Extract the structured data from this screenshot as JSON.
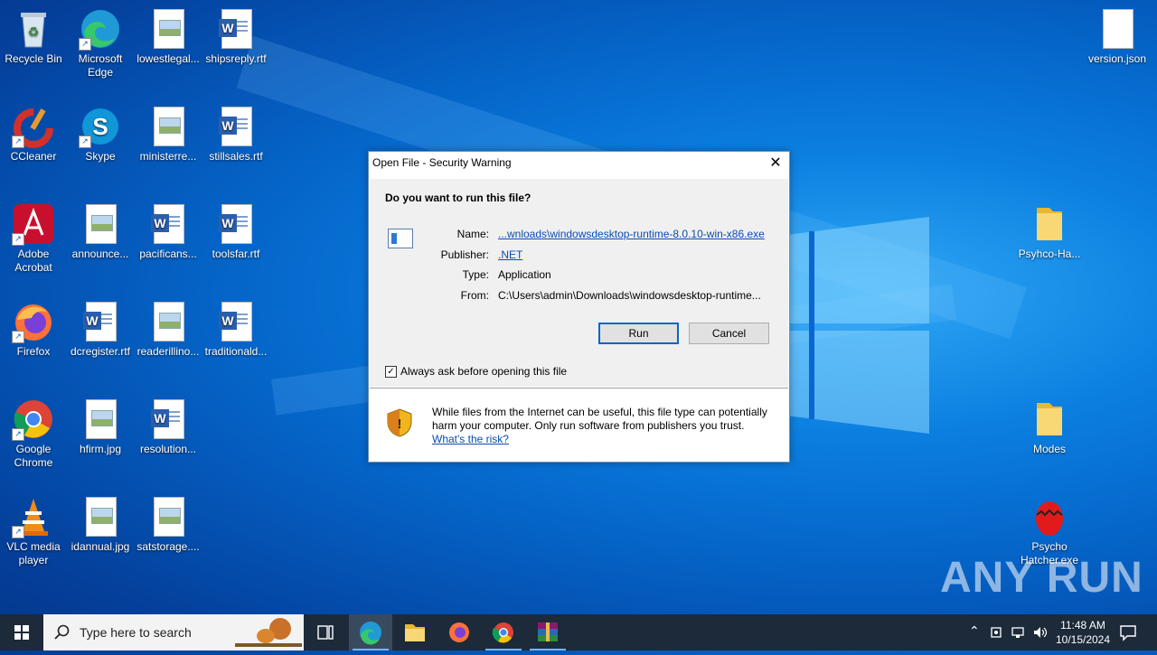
{
  "desktop": {
    "icons": [
      {
        "label": "Recycle Bin"
      },
      {
        "label": "Microsoft Edge"
      },
      {
        "label": "lowestlegal..."
      },
      {
        "label": "shipsreply.rtf"
      },
      {
        "label": "CCleaner"
      },
      {
        "label": "Skype"
      },
      {
        "label": "ministerre..."
      },
      {
        "label": "stillsales.rtf"
      },
      {
        "label": "Adobe Acrobat"
      },
      {
        "label": "announce..."
      },
      {
        "label": "pacificans..."
      },
      {
        "label": "toolsfar.rtf"
      },
      {
        "label": "Firefox"
      },
      {
        "label": "dcregister.rtf"
      },
      {
        "label": "readerillino..."
      },
      {
        "label": "traditionald..."
      },
      {
        "label": "Google Chrome"
      },
      {
        "label": "hfirm.jpg"
      },
      {
        "label": "resolution..."
      },
      {
        "label": "VLC media player"
      },
      {
        "label": "idannual.jpg"
      },
      {
        "label": "satstorage...."
      },
      {
        "label": "version.json"
      },
      {
        "label": "Psyhco-Ha..."
      },
      {
        "label": "Modes"
      },
      {
        "label": "Psycho Hatcher.exe"
      }
    ]
  },
  "dialog": {
    "title": "Open File - Security Warning",
    "close_glyph": "✕",
    "question": "Do you want to run this file?",
    "name_label": "Name:",
    "name_value": "...wnloads\\windowsdesktop-runtime-8.0.10-win-x86.exe",
    "publisher_label": "Publisher:",
    "publisher_value": ".NET",
    "type_label": "Type:",
    "type_value": "Application",
    "from_label": "From:",
    "from_value": "C:\\Users\\admin\\Downloads\\windowsdesktop-runtime...",
    "run_label": "Run",
    "cancel_label": "Cancel",
    "checkbox_label": "Always ask before opening this file",
    "checkbox_checked": true,
    "warning_text": "While files from the Internet can be useful, this file type can potentially harm your computer. Only run software from publishers you trust.",
    "risk_link": "What's the risk?"
  },
  "taskbar": {
    "search_placeholder": "Type here to search",
    "time": "11:48 AM",
    "date": "10/15/2024"
  },
  "watermark": "ANY RUN"
}
